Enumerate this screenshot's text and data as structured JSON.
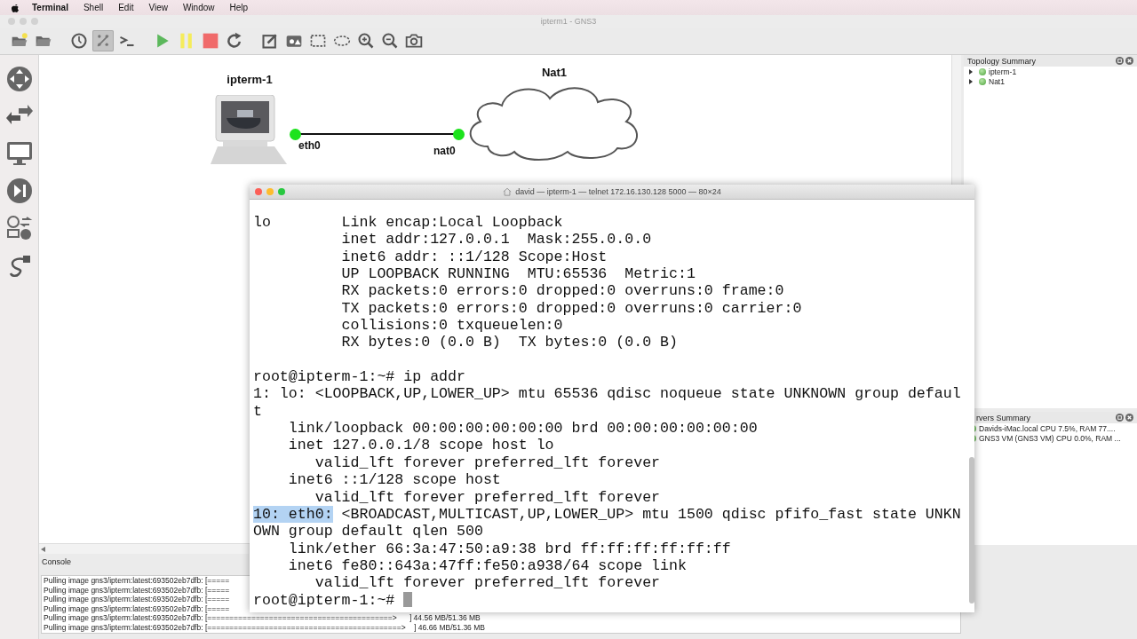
{
  "menu_bar": {
    "items": [
      {
        "label": "Terminal",
        "kind": "app"
      },
      {
        "label": "Shell",
        "kind": "menu"
      },
      {
        "label": "Edit",
        "kind": "menu"
      },
      {
        "label": "View",
        "kind": "menu"
      },
      {
        "label": "Window",
        "kind": "menu"
      },
      {
        "label": "Help",
        "kind": "menu"
      }
    ]
  },
  "window": {
    "title": "ipterm1 - GNS3"
  },
  "toolbar": [
    {
      "kind": "new-project",
      "pressed": false
    },
    {
      "kind": "open",
      "pressed": false
    },
    {
      "kind": "sep"
    },
    {
      "kind": "snapshot",
      "pressed": false
    },
    {
      "kind": "labels",
      "pressed": true
    },
    {
      "kind": "console",
      "pressed": false
    },
    {
      "kind": "sep"
    },
    {
      "kind": "start",
      "pressed": false
    },
    {
      "kind": "suspend",
      "pressed": false
    },
    {
      "kind": "stop",
      "pressed": false
    },
    {
      "kind": "reload",
      "pressed": false
    },
    {
      "kind": "sep"
    },
    {
      "kind": "note",
      "pressed": false
    },
    {
      "kind": "image",
      "pressed": false
    },
    {
      "kind": "rectangle",
      "pressed": false
    },
    {
      "kind": "ellipse",
      "pressed": false
    },
    {
      "kind": "zoom-in",
      "pressed": false
    },
    {
      "kind": "zoom-out",
      "pressed": false
    },
    {
      "kind": "screenshot",
      "pressed": false
    }
  ],
  "device_dock": [
    {
      "kind": "routers"
    },
    {
      "kind": "switches"
    },
    {
      "kind": "end-devices"
    },
    {
      "kind": "security"
    },
    {
      "kind": "all-devices"
    },
    {
      "kind": "add-link"
    }
  ],
  "topology": {
    "nodes": [
      {
        "name": "ipterm-1",
        "kind": "host",
        "port": "eth0"
      },
      {
        "name": "Nat1",
        "kind": "cloud",
        "port": "nat0"
      }
    ]
  },
  "topology_summary": {
    "title": "Topology Summary",
    "items": [
      {
        "name": "ipterm-1",
        "expanded": false
      },
      {
        "name": "Nat1",
        "expanded": false
      }
    ]
  },
  "servers_summary": {
    "title": "rvers Summary",
    "items": [
      "Davids-iMac.local CPU 7.5%, RAM 77....",
      "GNS3 VM (GNS3 VM) CPU 0.0%, RAM ..."
    ]
  },
  "console": {
    "title": "Console",
    "lines": [
      "Pulling image gns3/ipterm:latest:693502eb7dfb: [=====",
      "Pulling image gns3/ipterm:latest:693502eb7dfb: [=====",
      "Pulling image gns3/ipterm:latest:693502eb7dfb: [=====",
      "Pulling image gns3/ipterm:latest:693502eb7dfb: [=====",
      "Pulling image gns3/ipterm:latest:693502eb7dfb: [==========================================>      ] 44.56 MB/51.36 MB",
      "Pulling image gns3/ipterm:latest:693502eb7dfb: [============================================>    ] 46.66 MB/51.36 MB"
    ]
  },
  "terminal": {
    "title": "david — ipterm-1 — telnet 172.16.130.128 5000 — 80×24",
    "lines": [
      {
        "kind": "text",
        "text": "lo        Link encap:Local Loopback"
      },
      {
        "kind": "text",
        "text": "          inet addr:127.0.0.1  Mask:255.0.0.0"
      },
      {
        "kind": "text",
        "text": "          inet6 addr: ::1/128 Scope:Host"
      },
      {
        "kind": "text",
        "text": "          UP LOOPBACK RUNNING  MTU:65536  Metric:1"
      },
      {
        "kind": "text",
        "text": "          RX packets:0 errors:0 dropped:0 overruns:0 frame:0"
      },
      {
        "kind": "text",
        "text": "          TX packets:0 errors:0 dropped:0 overruns:0 carrier:0"
      },
      {
        "kind": "text",
        "text": "          collisions:0 txqueuelen:0"
      },
      {
        "kind": "text",
        "text": "          RX bytes:0 (0.0 B)  TX bytes:0 (0.0 B)"
      },
      {
        "kind": "blank"
      },
      {
        "kind": "text",
        "text": "root@ipterm-1:~# ip addr"
      },
      {
        "kind": "text",
        "text": "1: lo: <LOOPBACK,UP,LOWER_UP> mtu 65536 qdisc noqueue state UNKNOWN group defaul"
      },
      {
        "kind": "text",
        "text": "t"
      },
      {
        "kind": "text",
        "text": "    link/loopback 00:00:00:00:00:00 brd 00:00:00:00:00:00"
      },
      {
        "kind": "text",
        "text": "    inet 127.0.0.1/8 scope host lo"
      },
      {
        "kind": "text",
        "text": "       valid_lft forever preferred_lft forever"
      },
      {
        "kind": "text",
        "text": "    inet6 ::1/128 scope host"
      },
      {
        "kind": "text",
        "text": "       valid_lft forever preferred_lft forever"
      },
      {
        "kind": "selected",
        "selection": "10: eth0:",
        "text": " <BROADCAST,MULTICAST,UP,LOWER_UP> mtu 1500 qdisc pfifo_fast state UNKN"
      },
      {
        "kind": "text",
        "text": "OWN group default qlen 500"
      },
      {
        "kind": "text",
        "text": "    link/ether 66:3a:47:50:a9:38 brd ff:ff:ff:ff:ff:ff"
      },
      {
        "kind": "text",
        "text": "    inet6 fe80::643a:47ff:fe50:a938/64 scope link"
      },
      {
        "kind": "text",
        "text": "       valid_lft forever preferred_lft forever"
      },
      {
        "kind": "prompt",
        "text": "root@ipterm-1:~#"
      }
    ]
  }
}
